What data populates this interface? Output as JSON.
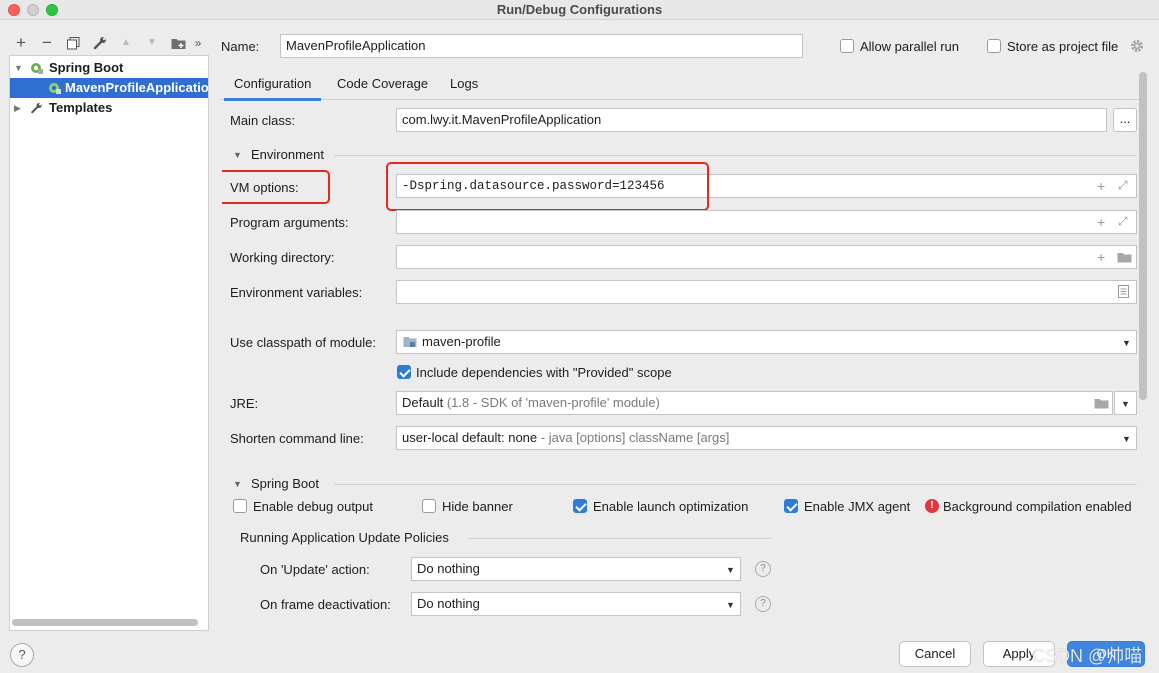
{
  "window": {
    "title": "Run/Debug Configurations"
  },
  "toolbar": {
    "add": "+",
    "remove": "−",
    "more": "»"
  },
  "tree": {
    "items": [
      {
        "label": "Spring Boot"
      },
      {
        "label": "MavenProfileApplication"
      },
      {
        "label": "Templates"
      }
    ]
  },
  "header": {
    "name_label": "Name:",
    "name_value": "MavenProfileApplication",
    "allow_parallel_label": "Allow parallel run",
    "allow_parallel_checked": false,
    "store_label": "Store as project file",
    "store_checked": false
  },
  "tabs": [
    {
      "label": "Configuration"
    },
    {
      "label": "Code Coverage"
    },
    {
      "label": "Logs"
    }
  ],
  "form": {
    "main_class_label": "Main class:",
    "main_class_value": "com.lwy.it.MavenProfileApplication",
    "browse_label": "...",
    "environment_label": "Environment",
    "vm_options_label": "VM options:",
    "vm_options_value": "-Dspring.datasource.password=123456",
    "program_args_label": "Program arguments:",
    "working_dir_label": "Working directory:",
    "env_vars_label": "Environment variables:",
    "classpath_label": "Use classpath of module:",
    "classpath_value": "maven-profile",
    "include_deps_label": "Include dependencies with \"Provided\" scope",
    "include_deps_checked": true,
    "jre_label": "JRE:",
    "jre_value": "Default",
    "jre_hint": "(1.8 - SDK of 'maven-profile' module)",
    "shorten_label": "Shorten command line:",
    "shorten_value": "user-local default: none",
    "shorten_hint": "- java [options] className [args]"
  },
  "spring_boot": {
    "section_label": "Spring Boot",
    "debug_label": "Enable debug output",
    "hide_banner_label": "Hide banner",
    "launch_opt_label": "Enable launch optimization",
    "jmx_label": "Enable JMX agent",
    "bg_compile_label": "Background compilation enabled",
    "policies_label": "Running Application Update Policies",
    "update_label": "On 'Update' action:",
    "update_value": "Do nothing",
    "frame_label": "On frame deactivation:",
    "frame_value": "Do nothing"
  },
  "buttons": {
    "help": "?",
    "cancel": "Cancel",
    "apply": "Apply",
    "ok": "OK"
  },
  "watermark": "CSDN @帅喵",
  "colors": {
    "accent": "#3f86e0",
    "selection": "#2f6fcf",
    "highlight": "#e5271e",
    "spring_green": "#6ab04c"
  }
}
